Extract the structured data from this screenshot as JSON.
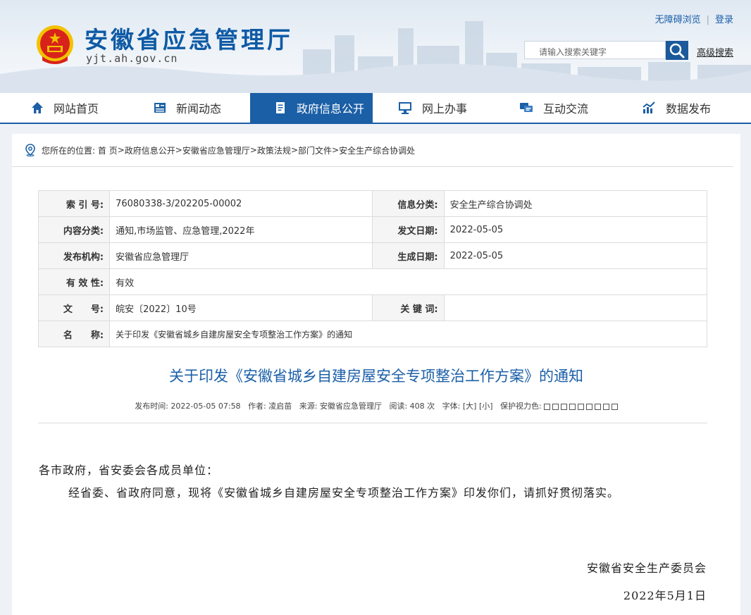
{
  "site": {
    "title": "安徽省应急管理厅",
    "url": "yjt.ah.gov.cn",
    "toplinks": {
      "accessible": "无障碍浏览",
      "login": "登录"
    },
    "search": {
      "placeholder": "请输入搜索关键字",
      "advanced": "高级搜索"
    }
  },
  "nav": {
    "items": [
      {
        "label": "网站首页",
        "icon": "home-icon"
      },
      {
        "label": "新闻动态",
        "icon": "news-icon"
      },
      {
        "label": "政府信息公开",
        "icon": "document-icon",
        "active": true
      },
      {
        "label": "网上办事",
        "icon": "monitor-icon"
      },
      {
        "label": "互动交流",
        "icon": "chat-icon"
      },
      {
        "label": "数据发布",
        "icon": "chart-icon"
      }
    ]
  },
  "breadcrumb": {
    "prefix": "您所在的位置:",
    "items": [
      "首 页",
      "政府信息公开",
      "安徽省应急管理厅",
      "政策法规",
      "部门文件",
      "安全生产综合协调处"
    ],
    "sep": " > "
  },
  "meta": {
    "index_label": "索 引 号:",
    "index": "76080338-3/202205-00002",
    "category_label": "信息分类:",
    "category": "安全生产综合协调处",
    "content_label": "内容分类:",
    "content": "通知,市场监管、应急管理,2022年",
    "issue_date_label": "发文日期:",
    "issue_date": "2022-05-05",
    "publisher_label": "发布机构:",
    "publisher": "安徽省应急管理厅",
    "created_label": "生成日期:",
    "created": "2022-05-05",
    "validity_label": "有 效 性:",
    "validity": "有效",
    "docno_label": "文　　号:",
    "docno": "皖安〔2022〕10号",
    "keywords_label": "关 键 词:",
    "keywords": "",
    "name_label": "名　　称:",
    "name": "关于印发《安徽省城乡自建房屋安全专项整治工作方案》的通知"
  },
  "article": {
    "title": "关于印发《安徽省城乡自建房屋安全专项整治工作方案》的通知",
    "info": {
      "time": "发布时间: 2022-05-05 07:58",
      "author": "作者: 凌启苗",
      "source": "来源: 安徽省应急管理厅",
      "views": "阅读: 408 次",
      "font": "字体: [大] [小]",
      "eye": "保护视力色:"
    },
    "salutation": "各市政府，省安委会各成员单位：",
    "paragraph": "经省委、省政府同意，现将《安徽省城乡自建房屋安全专项整治工作方案》印发你们，请抓好贯彻落实。",
    "signature": "安徽省安全生产委员会",
    "date": "2022年5月1日"
  },
  "colors": {
    "brand": "#1b5fa6",
    "title": "#1a5fa8"
  }
}
